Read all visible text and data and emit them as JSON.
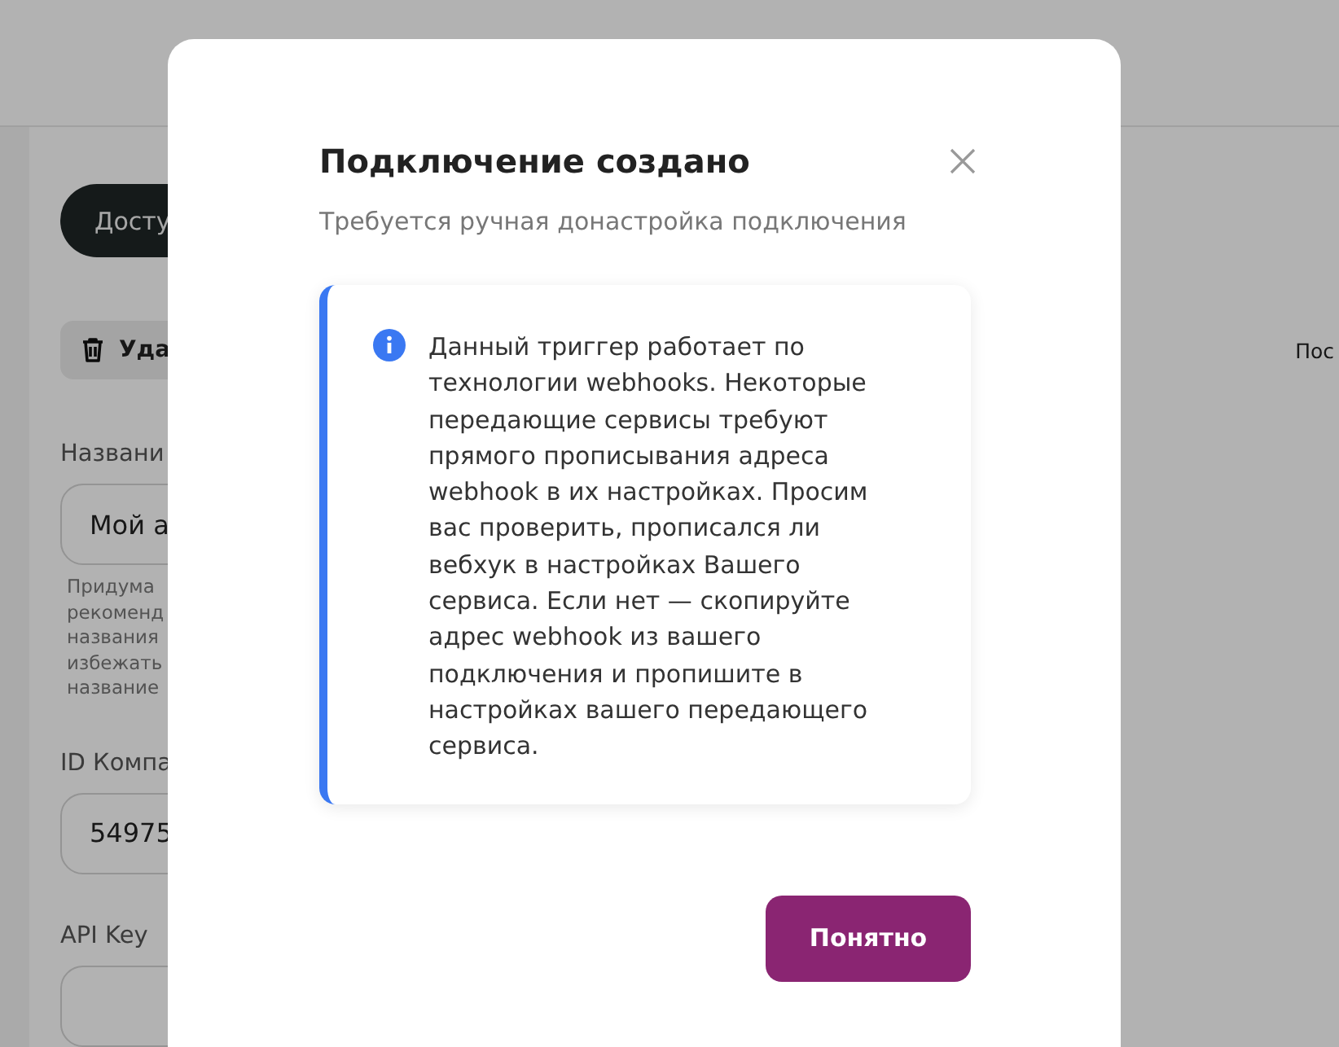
{
  "background": {
    "access_button": "Досту",
    "delete_button": "Уда",
    "right_text": "Пос",
    "name_label": "Названи",
    "name_value": "Мой а",
    "name_hint": "Придума\nрекоменд\nназвания\nизбежать\nназвание",
    "company_label": "ID Компа",
    "company_value": "54975",
    "api_label": "API Key"
  },
  "dialog": {
    "title": "Подключение создано",
    "subtitle": "Требуется ручная донастройка подключения",
    "info_text": "Данный триггер работает по технологии webhooks. Некоторые передающие сервисы требуют прямого прописывания адреса webhook в их настройках. Просим вас проверить, прописался ли вебхук в настройках Вашего сервиса. Если нет — скопируйте адрес webhook из вашего подключения и пропишите в настройках вашего передающего сервиса.",
    "confirm_button": "Понятно"
  }
}
